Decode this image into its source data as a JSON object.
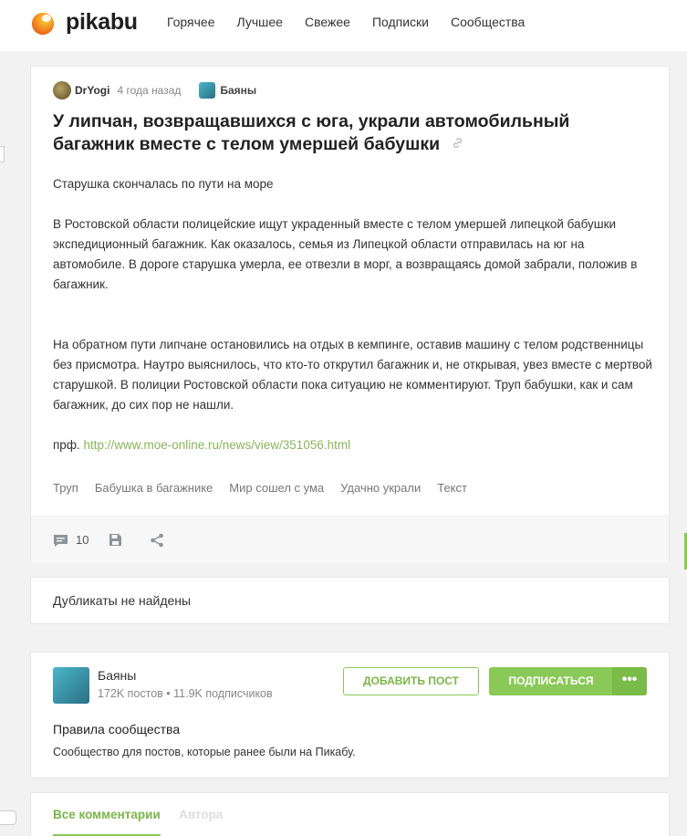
{
  "header": {
    "logo_text": "pikabu",
    "nav": [
      "Горячее",
      "Лучшее",
      "Свежее",
      "Подписки",
      "Сообщества"
    ]
  },
  "post": {
    "author": "DrYogi",
    "time": "4 года назад",
    "community": "Баяны",
    "title": "У липчан, возвращавшихся с юга, украли автомобильный багажник вместе с телом умершей бабушки",
    "body_p1": "Старушка скончалась по пути на море",
    "body_p2": "В Ростовской области полицейские ищут украденный вместе с телом умершей липецкой бабушки экспедиционный багажник. Как оказалось, семья из Липецкой области отправилась на юг на автомобиле. В дороге старушка умерла, ее отвезли в морг, а возвращаясь домой забрали, положив в багажник.",
    "body_p3": "На обратном пути липчане остановились на отдых в кемпинге, оставив машину с телом родственницы без присмотра. Наутро выяснилось, что кто-то открутил багажник и, не открывая, увез вместе с мертвой старушкой. В полиции Ростовской области пока ситуацию не комментируют. Труп бабушки, как и сам багажник, до сих пор не нашли.",
    "source_prefix": "прф.",
    "source_link": "http://www.moe-online.ru/news/view/351056.html",
    "tags": [
      "Труп",
      "Бабушка в багажнике",
      "Мир сошел с ума",
      "Удачно украли",
      "Текст"
    ],
    "comments_count": "10"
  },
  "duplicates": {
    "text": "Дубликаты не найдены"
  },
  "community_block": {
    "name": "Баяны",
    "stats": "172K постов • 11.9K подписчиков",
    "add_post": "ДОБАВИТЬ ПОСТ",
    "subscribe": "ПОДПИСАТЬСЯ",
    "more": "•••",
    "rules_title": "Правила сообщества",
    "rules_text": "Сообщество для постов, которые ранее были на Пикабу."
  },
  "comments_tabs": {
    "all": "Все комментарии",
    "author": "Автора"
  },
  "colors": {
    "accent": "#8ac858",
    "link": "#8ab45b"
  }
}
